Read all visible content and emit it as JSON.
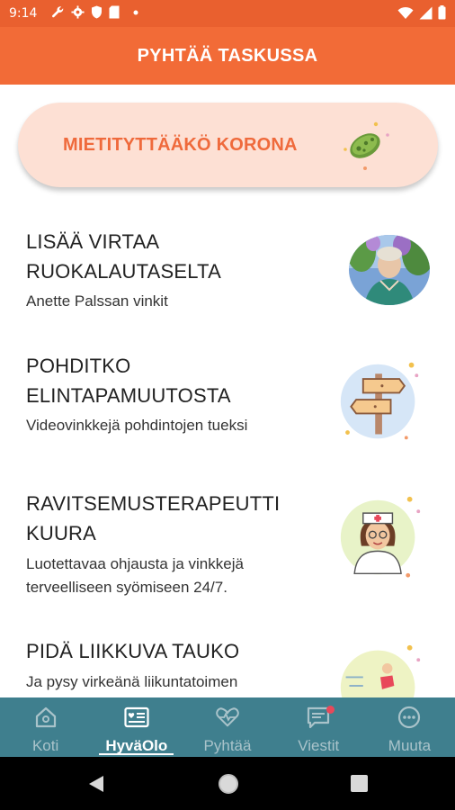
{
  "status_bar": {
    "time": "9:14",
    "icons": [
      "wrench-icon",
      "gear-icon",
      "shield-icon",
      "sd-card-icon",
      "dot-icon"
    ],
    "right_icons": [
      "wifi-icon",
      "signal-icon",
      "battery-icon"
    ]
  },
  "app_bar": {
    "title": "PYHTÄÄ TASKUSSA"
  },
  "corona_card": {
    "label": "MIETITYTTÄÄKÖ KORONA",
    "icon": "virus-icon"
  },
  "items": [
    {
      "title_line1": "LISÄÄ VIRTAA",
      "title_line2": "RUOKALAUTASELTA",
      "sub_line1": "Anette Palssan vinkit",
      "sub_line2": "",
      "icon": "portrait-photo"
    },
    {
      "title_line1": "POHDITKO",
      "title_line2": "ELINTAPAMUUTOSTA",
      "sub_line1": "Videovinkkejä pohdintojen tueksi",
      "sub_line2": "",
      "icon": "signpost-icon"
    },
    {
      "title_line1": "RAVITSEMUSTERAPEUTTI",
      "title_line2": "KUURA",
      "sub_line1": "Luotettavaa ohjausta ja vinkkejä",
      "sub_line2": "terveelliseen syömiseen 24/7.",
      "icon": "nurse-icon"
    },
    {
      "title_line1": "PIDÄ LIIKKUVA TAUKO",
      "title_line2": "",
      "sub_line1": "Ja pysy virkeänä liikuntatoimen",
      "sub_line2": "",
      "icon": "runner-icon"
    }
  ],
  "bottom_nav": {
    "tabs": [
      {
        "label": "Koti",
        "icon": "home-icon",
        "active": false
      },
      {
        "label": "HyväOlo",
        "icon": "wellbeing-card-icon",
        "active": true
      },
      {
        "label": "Pyhtää",
        "icon": "heart-pulse-icon",
        "active": false
      },
      {
        "label": "Viestit",
        "icon": "message-icon",
        "active": false,
        "badge": true
      },
      {
        "label": "Muuta",
        "icon": "more-icon",
        "active": false
      }
    ]
  },
  "colors": {
    "header": "#f26b37",
    "accent_text": "#ef6a3c",
    "corona_bg": "#fde0d4",
    "nav_bg": "#3f7f8e",
    "nav_inactive": "#a9c3ca",
    "badge": "#e8485a"
  }
}
